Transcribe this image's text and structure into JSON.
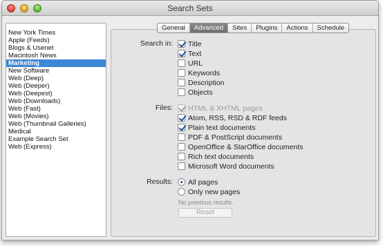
{
  "window": {
    "title": "Search Sets"
  },
  "sidebar": {
    "items": [
      "New York Times",
      "Apple (Feeds)",
      "Blogs & Usenet",
      "Macintosh News",
      "Marketing",
      "New Software",
      "Web (Deep)",
      "Web (Deeper)",
      "Web (Deepest)",
      "Web (Downloads)",
      "Web (Fast)",
      "Web (Movies)",
      "Web (Thumbnail Galleries)",
      "Medical",
      "Example Search Set",
      "Web (Express)"
    ],
    "selected": "Marketing"
  },
  "tabs": [
    "General",
    "Advanced",
    "Sites",
    "Plugins",
    "Actions",
    "Schedule"
  ],
  "active_tab": "Advanced",
  "search_in": {
    "label": "Search in:",
    "options": [
      {
        "label": "Title",
        "checked": true
      },
      {
        "label": "Text",
        "checked": true
      },
      {
        "label": "URL",
        "checked": false
      },
      {
        "label": "Keywords",
        "checked": false
      },
      {
        "label": "Description",
        "checked": false
      },
      {
        "label": "Objects",
        "checked": false
      }
    ]
  },
  "files": {
    "label": "Files:",
    "options": [
      {
        "label": "HTML & XHTML pages",
        "checked": true,
        "disabled": true
      },
      {
        "label": "Atom, RSS, RSD & RDF feeds",
        "checked": true,
        "disabled": false
      },
      {
        "label": "Plain text documents",
        "checked": true,
        "disabled": false
      },
      {
        "label": "PDF & PostScript documents",
        "checked": false,
        "disabled": false
      },
      {
        "label": "OpenOffice & StarOffice documents",
        "checked": false,
        "disabled": false
      },
      {
        "label": "Rich text documents",
        "checked": false,
        "disabled": false
      },
      {
        "label": "Microsoft Word documents",
        "checked": false,
        "disabled": false
      }
    ]
  },
  "results": {
    "label": "Results:",
    "options": [
      {
        "label": "All pages",
        "selected": true
      },
      {
        "label": "Only new pages",
        "selected": false
      }
    ],
    "note": "No previous results.",
    "reset_label": "Reset"
  }
}
